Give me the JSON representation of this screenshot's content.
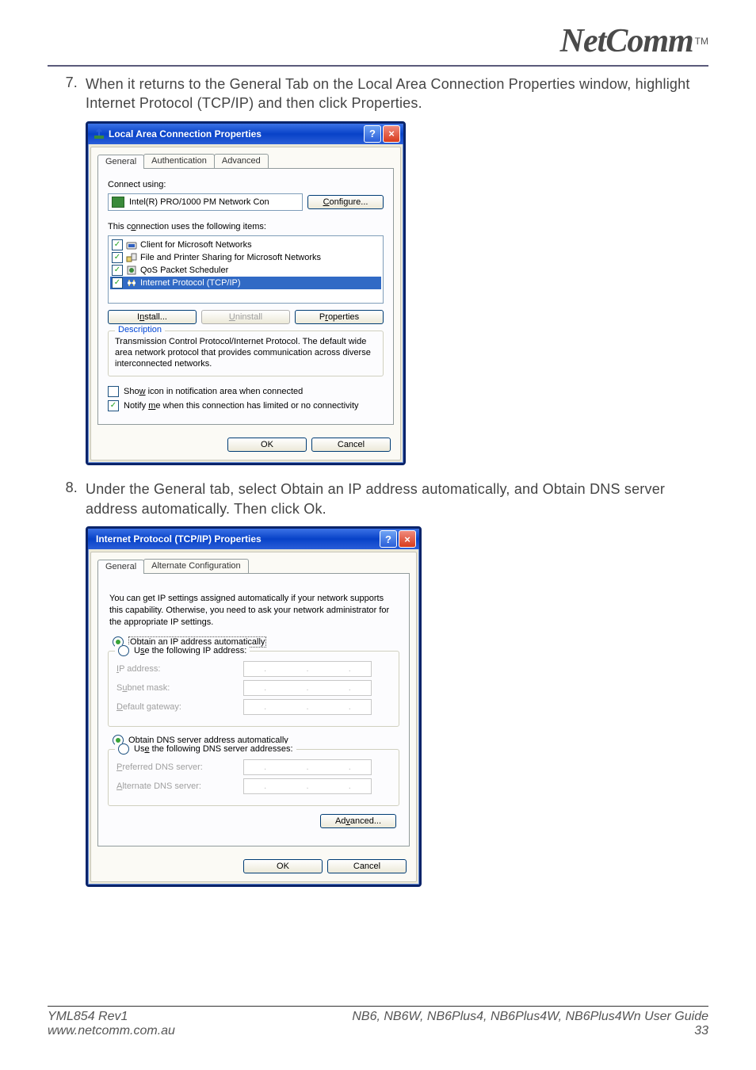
{
  "header": {
    "logo_text": "NetComm",
    "tm": "TM"
  },
  "step7": {
    "num": "7.",
    "text": "When it returns to the General Tab on the Local Area Connection Properties window, highlight Internet Protocol (TCP/IP) and then click Properties."
  },
  "dlg1": {
    "title": "Local Area Connection Properties",
    "tabs": [
      "General",
      "Authentication",
      "Advanced"
    ],
    "connect_using_label": "Connect using:",
    "nic": "Intel(R) PRO/1000 PM Network Con",
    "configure": "Configure...",
    "items_label": "This connection uses the following items:",
    "items": [
      {
        "checked": true,
        "label": "Client for Microsoft Networks"
      },
      {
        "checked": true,
        "label": "File and Printer Sharing for Microsoft Networks"
      },
      {
        "checked": true,
        "label": "QoS Packet Scheduler"
      },
      {
        "checked": true,
        "label": "Internet Protocol (TCP/IP)",
        "selected": true
      }
    ],
    "install": "Install...",
    "uninstall": "Uninstall",
    "properties": "Properties",
    "desc_legend": "Description",
    "desc_text": "Transmission Control Protocol/Internet Protocol. The default wide area network protocol that provides communication across diverse interconnected networks.",
    "show_icon": "Show icon in notification area when connected",
    "notify": "Notify me when this connection has limited or no connectivity",
    "show_icon_checked": false,
    "notify_checked": true,
    "ok": "OK",
    "cancel": "Cancel"
  },
  "step8": {
    "num": "8.",
    "text": "Under the General tab, select Obtain an IP address automatically, and Obtain DNS server address automatically. Then click Ok."
  },
  "dlg2": {
    "title": "Internet Protocol (TCP/IP) Properties",
    "tabs": [
      "General",
      "Alternate Configuration"
    ],
    "intro": "You can get IP settings assigned automatically if your network supports this capability. Otherwise, you need to ask your network administrator for the appropriate IP settings.",
    "r_obtain_ip": "Obtain an IP address automatically",
    "r_use_ip": "Use the following IP address:",
    "ip_label": "IP address:",
    "subnet_label": "Subnet mask:",
    "gw_label": "Default gateway:",
    "r_obtain_dns": "Obtain DNS server address automatically",
    "r_use_dns": "Use the following DNS server addresses:",
    "pref_dns": "Preferred DNS server:",
    "alt_dns": "Alternate DNS server:",
    "advanced": "Advanced...",
    "ok": "OK",
    "cancel": "Cancel"
  },
  "footer": {
    "left1": "YML854 Rev1",
    "left2": "www.netcomm.com.au",
    "right1a": "NB6, NB6W, NB6Plus4, NB6Plus4W, NB6Plus4Wn ",
    "right1b": "User Guide",
    "right2": "33"
  }
}
